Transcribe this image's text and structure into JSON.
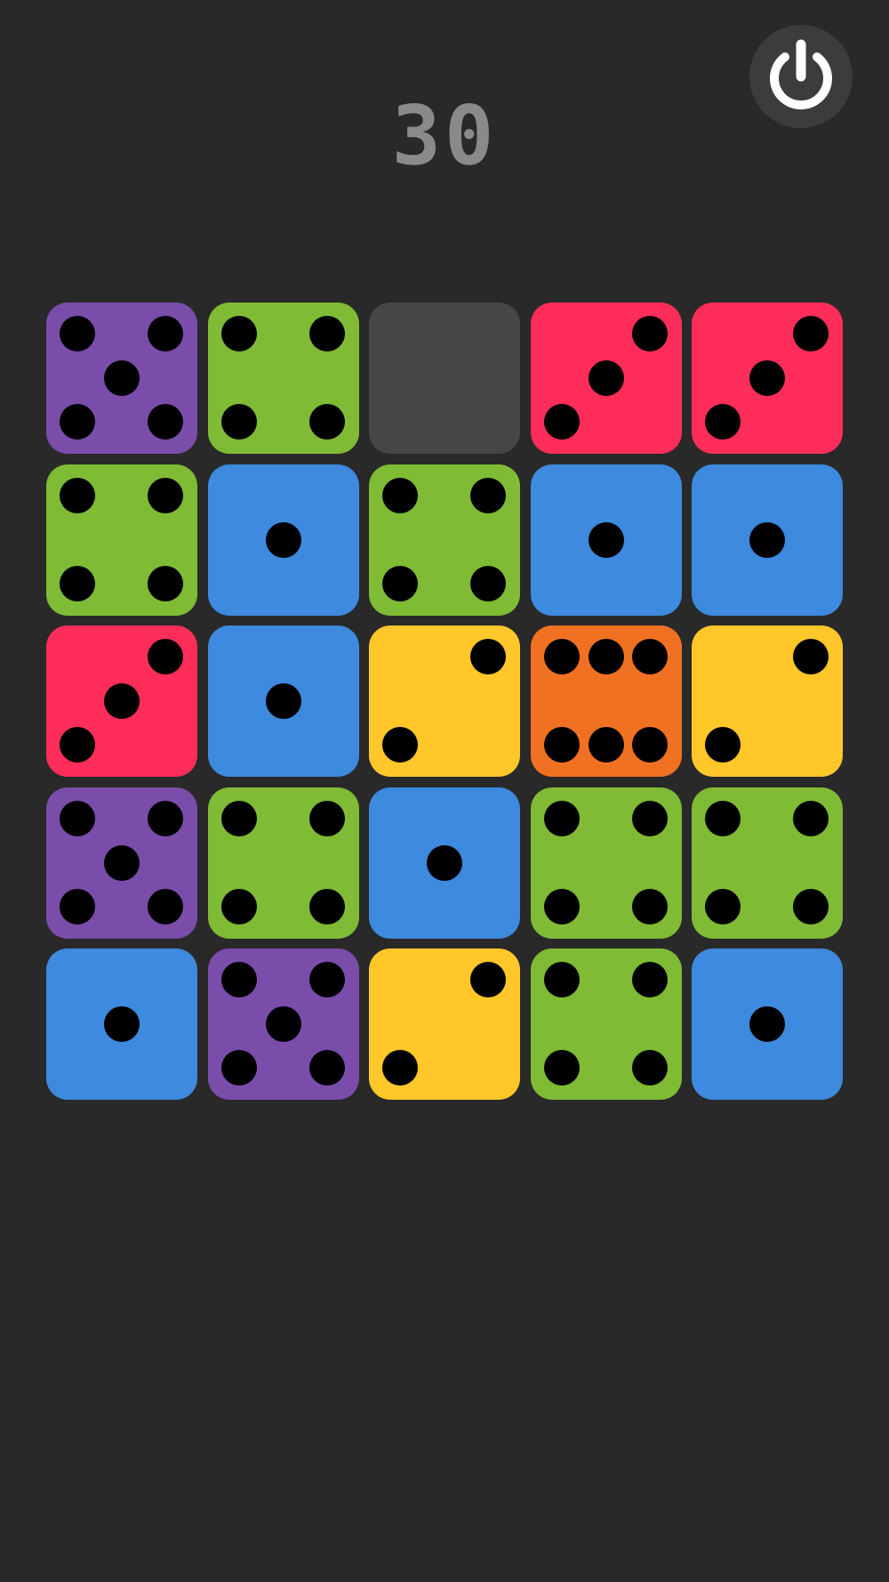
{
  "game": {
    "score": "30"
  },
  "controls": {
    "power_icon": "power-icon"
  },
  "colors": {
    "background": "#292929",
    "empty_cell": "#464646",
    "pip": "#000000",
    "score": "#8a8a8a",
    "power_button": "#3c3c3c",
    "power_symbol": "#ffffff"
  },
  "board": {
    "rows": 5,
    "cols": 5,
    "cells": [
      [
        {
          "value": 5,
          "color": "#7b4dab"
        },
        {
          "value": 4,
          "color": "#7fbb34"
        },
        {
          "value": 0,
          "color": "#464646"
        },
        {
          "value": 3,
          "color": "#ff2d5a"
        },
        {
          "value": 3,
          "color": "#ff2d5a"
        }
      ],
      [
        {
          "value": 4,
          "color": "#7fbb34"
        },
        {
          "value": 1,
          "color": "#3d8ade"
        },
        {
          "value": 4,
          "color": "#7fbb34"
        },
        {
          "value": 1,
          "color": "#3d8ade"
        },
        {
          "value": 1,
          "color": "#3d8ade"
        }
      ],
      [
        {
          "value": 3,
          "color": "#ff2d5a"
        },
        {
          "value": 1,
          "color": "#3d8ade"
        },
        {
          "value": 2,
          "color": "#ffc72a"
        },
        {
          "value": 6,
          "color": "#f17122"
        },
        {
          "value": 2,
          "color": "#ffc72a"
        }
      ],
      [
        {
          "value": 5,
          "color": "#7b4dab"
        },
        {
          "value": 4,
          "color": "#7fbb34"
        },
        {
          "value": 1,
          "color": "#3d8ade"
        },
        {
          "value": 4,
          "color": "#7fbb34"
        },
        {
          "value": 4,
          "color": "#7fbb34"
        }
      ],
      [
        {
          "value": 1,
          "color": "#3d8ade"
        },
        {
          "value": 5,
          "color": "#7b4dab"
        },
        {
          "value": 2,
          "color": "#ffc72a"
        },
        {
          "value": 4,
          "color": "#7fbb34"
        },
        {
          "value": 1,
          "color": "#3d8ade"
        }
      ]
    ]
  }
}
